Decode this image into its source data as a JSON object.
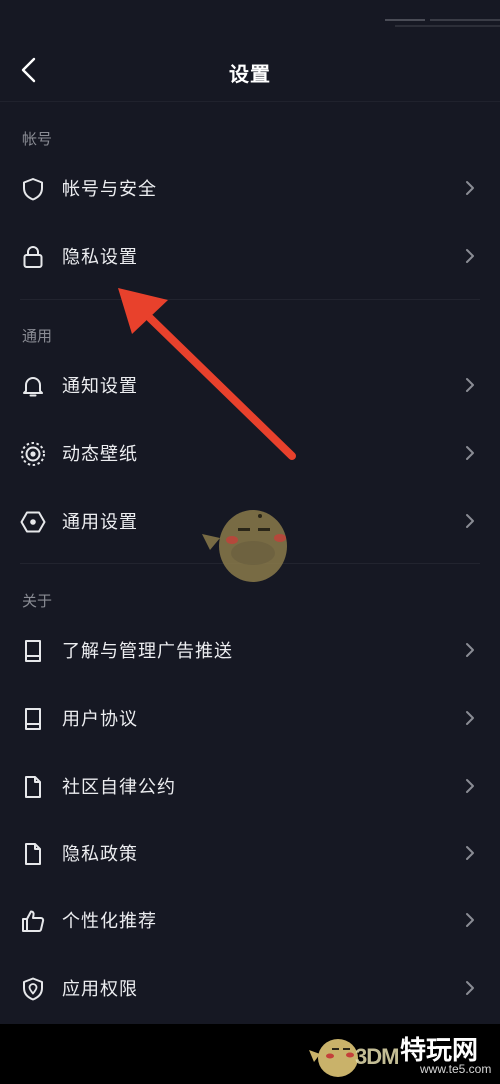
{
  "header": {
    "title": "设置"
  },
  "sections": [
    {
      "title": "帐号",
      "items": [
        {
          "label": "帐号与安全",
          "icon": "shield-icon"
        },
        {
          "label": "隐私设置",
          "icon": "lock-icon"
        }
      ]
    },
    {
      "title": "通用",
      "items": [
        {
          "label": "通知设置",
          "icon": "bell-icon"
        },
        {
          "label": "动态壁纸",
          "icon": "live-wallpaper-icon"
        },
        {
          "label": "通用设置",
          "icon": "hexagon-settings-icon"
        }
      ]
    },
    {
      "title": "关于",
      "items": [
        {
          "label": "了解与管理广告推送",
          "icon": "book-icon"
        },
        {
          "label": "用户协议",
          "icon": "book-icon"
        },
        {
          "label": "社区自律公约",
          "icon": "document-icon"
        },
        {
          "label": "隐私政策",
          "icon": "document-icon"
        },
        {
          "label": "个性化推荐",
          "icon": "thumbs-up-icon"
        },
        {
          "label": "应用权限",
          "icon": "shield-location-icon"
        }
      ]
    }
  ],
  "annotation": {
    "color": "#e8412c"
  },
  "watermark": {
    "brand": "3DM",
    "logo": "特玩网",
    "url": "www.te5.com"
  },
  "colors": {
    "background": "#161823",
    "text": "#ecedf0",
    "section_title": "#8a8c94"
  }
}
